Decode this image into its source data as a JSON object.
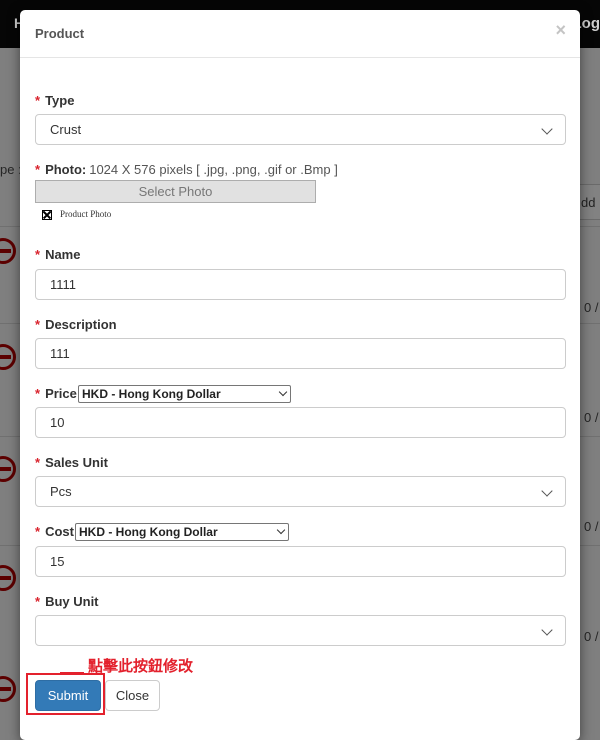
{
  "background": {
    "header_left": "H",
    "header_right": "Log",
    "type_label": "pe :",
    "add_button": "dd F",
    "row_fraction": "0 /"
  },
  "modal": {
    "title": "Product",
    "close_glyph": "×",
    "required_mark": "*",
    "type": {
      "label": "Type",
      "value": "Crust"
    },
    "photo": {
      "label": "Photo:",
      "hint": "1024 X 576 pixels [ .jpg, .png, .gif or .Bmp ]",
      "button": "Select Photo",
      "alt_text": "Product Photo"
    },
    "name": {
      "label": "Name",
      "value": "1111"
    },
    "description": {
      "label": "Description",
      "value": "111"
    },
    "price": {
      "label": "Price",
      "currency": "HKD - Hong Kong Dollar",
      "value": "10"
    },
    "sales_unit": {
      "label": "Sales Unit",
      "value": "Pcs"
    },
    "cost": {
      "label": "Cost",
      "currency": "HKD - Hong Kong Dollar",
      "value": "15"
    },
    "buy_unit": {
      "label": "Buy Unit",
      "value": ""
    },
    "buttons": {
      "submit": "Submit",
      "close": "Close"
    }
  },
  "annotation": {
    "text": "點擊此按鈕修改"
  },
  "colors": {
    "primary": "#337ab7",
    "required": "#d9232d",
    "annotation": "#e3212d",
    "remove_icon": "#5c0000"
  }
}
